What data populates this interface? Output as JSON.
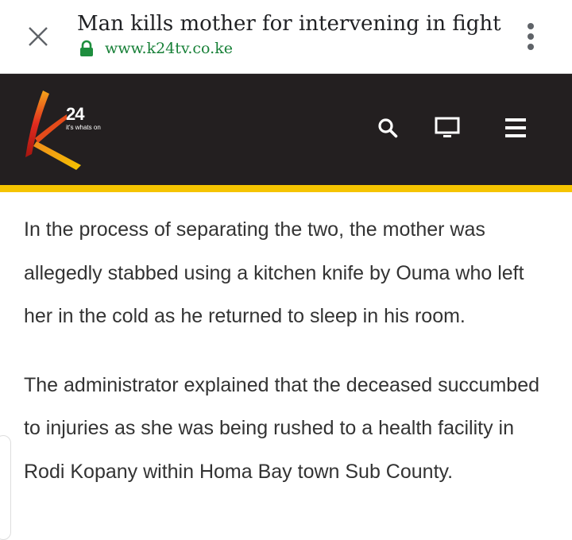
{
  "browser": {
    "title": "Man kills mother for intervening in fight",
    "url": "www.k24tv.co.ke",
    "icons": {
      "close": "close-icon",
      "lock": "lock-icon",
      "menu": "more-vert-icon"
    },
    "colors": {
      "url": "#188038",
      "lock": "#1e8e3e"
    }
  },
  "site_header": {
    "logo_number": "24",
    "logo_tagline": "it's whats on",
    "icons": [
      "search-icon",
      "tv-icon",
      "hamburger-menu-icon"
    ],
    "colors": {
      "background": "#231f20",
      "accent": "#f5c400",
      "logo_red": "#e12b1f",
      "logo_yellow": "#f5c400"
    }
  },
  "article": {
    "paragraphs": [
      "In the process of separating the two, the mother was allegedly stabbed using a kitchen knife by Ouma who left her in the cold as he returned to sleep in his room.",
      "The administrator explained that the deceased succumbed to injuries as she was being rushed to a health facility in Rodi Kopany within Homa Bay town Sub County."
    ]
  }
}
